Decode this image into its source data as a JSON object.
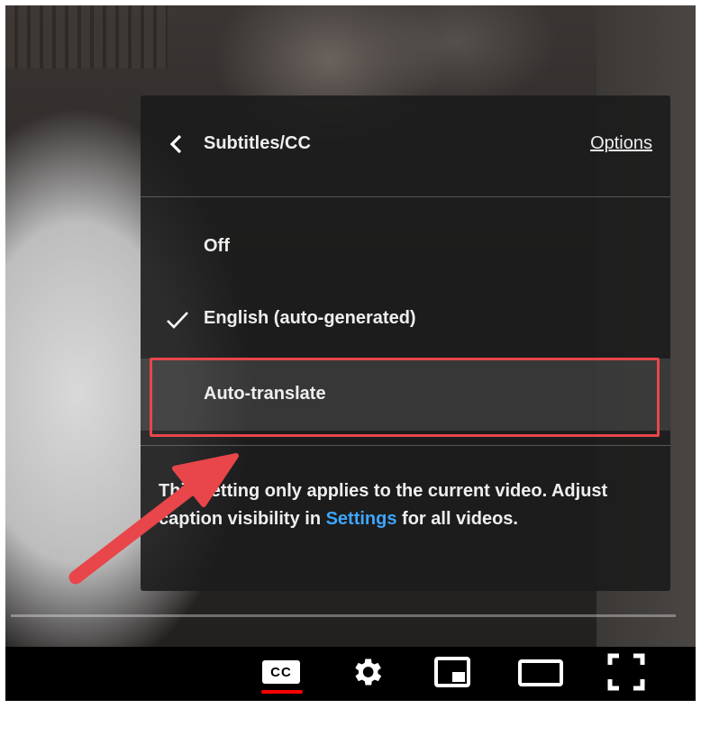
{
  "menu": {
    "title": "Subtitles/CC",
    "options_label": "Options",
    "items": [
      {
        "label": "Off",
        "selected": false
      },
      {
        "label": "English (auto-generated)",
        "selected": true
      },
      {
        "label": "Auto-translate",
        "selected": false
      }
    ],
    "note": {
      "before": "This setting only applies to the current video. Adjust caption visibility in ",
      "link": "Settings",
      "after": " for all videos."
    }
  },
  "controls": {
    "cc_label": "CC",
    "icons": [
      "subtitles-icon",
      "gear-icon",
      "miniplayer-icon",
      "theater-mode-icon",
      "fullscreen-icon"
    ]
  },
  "colors": {
    "cc_active_underline": "#ff0000",
    "highlight": "#e8464a",
    "link": "#3ea6ff"
  }
}
